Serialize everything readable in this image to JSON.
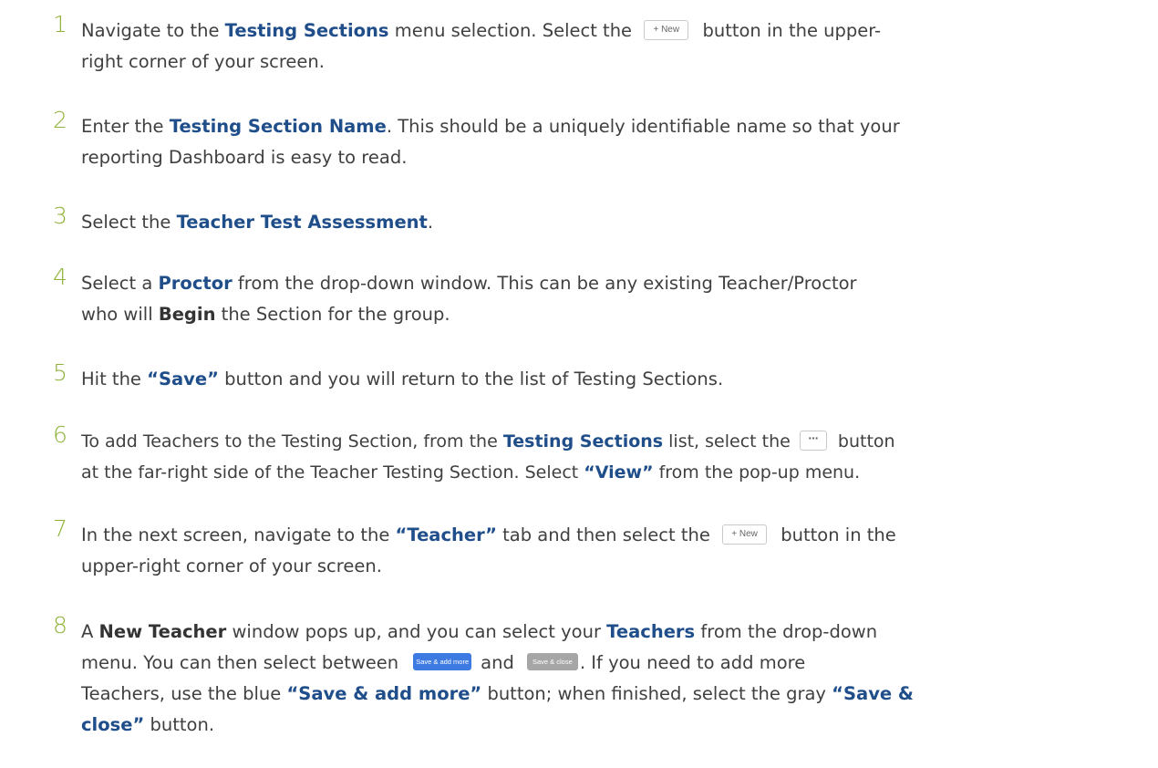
{
  "steps": [
    {
      "number": "1",
      "p1": "Navigate to the ",
      "h1": "Testing Sections",
      "p2": " menu selection. Select the ",
      "button": "+ New",
      "p3": " button in the upper-",
      "line2": "right corner of your screen."
    },
    {
      "number": "2",
      "p1": "Enter the ",
      "h1": "Testing Section Name",
      "p2": ". This should be a uniquely identifiable name so that your",
      "line2": "reporting Dashboard is easy to read."
    },
    {
      "number": "3",
      "p1": "Select the ",
      "h1": "Teacher Test Assessment",
      "p2": "."
    },
    {
      "number": "4",
      "p1": "Select a ",
      "h1": "Proctor",
      "p2": " from the drop-down window. This can be any existing Teacher/Proctor",
      "l2a": "who will ",
      "b1": "Begin",
      "l2b": " the Section for the group."
    },
    {
      "number": "5",
      "p1": "Hit the ",
      "h1": "“Save”",
      "p2": " button and you will return to the list of Testing Sections."
    },
    {
      "number": "6",
      "p1": "To add Teachers to the Testing Section, from the ",
      "h1": "Testing Sections",
      "p2": " list, select the ",
      "button": "···",
      "p3": " button",
      "l2a": "at the far-right side of the Teacher Testing Section. Select ",
      "h2": "“View”",
      "l2b": " from the pop-up menu."
    },
    {
      "number": "7",
      "p1": "In the next screen, navigate to the ",
      "h1": "“Teacher”",
      "p2": " tab and then select the ",
      "button": "+ New",
      "p3": " button in the",
      "line2": "upper-right corner of your screen."
    },
    {
      "number": "8",
      "p1": "A ",
      "b1": "New Teacher",
      "p2": " window pops up, and you can select your ",
      "h1": "Teachers",
      "p3": " from the drop-down",
      "l2a": "menu. You can then select between",
      "btn_blue": "Save & add more",
      "l2b": "and",
      "btn_gray": "Save & close",
      "l2c": ". If you need to add more",
      "l3a": "Teachers, use the blue ",
      "h2": "“Save & add more”",
      "l3b": " button; when finished, select the gray ",
      "h3": "“Save &",
      "h4": "close”",
      "l4b": " button."
    }
  ],
  "colors": {
    "step_number": "#8fb33a",
    "highlight": "#1f4e8a",
    "body_text": "#404040",
    "save_add_more_button": "#3d7be3",
    "save_close_button": "#a6a6a6"
  }
}
